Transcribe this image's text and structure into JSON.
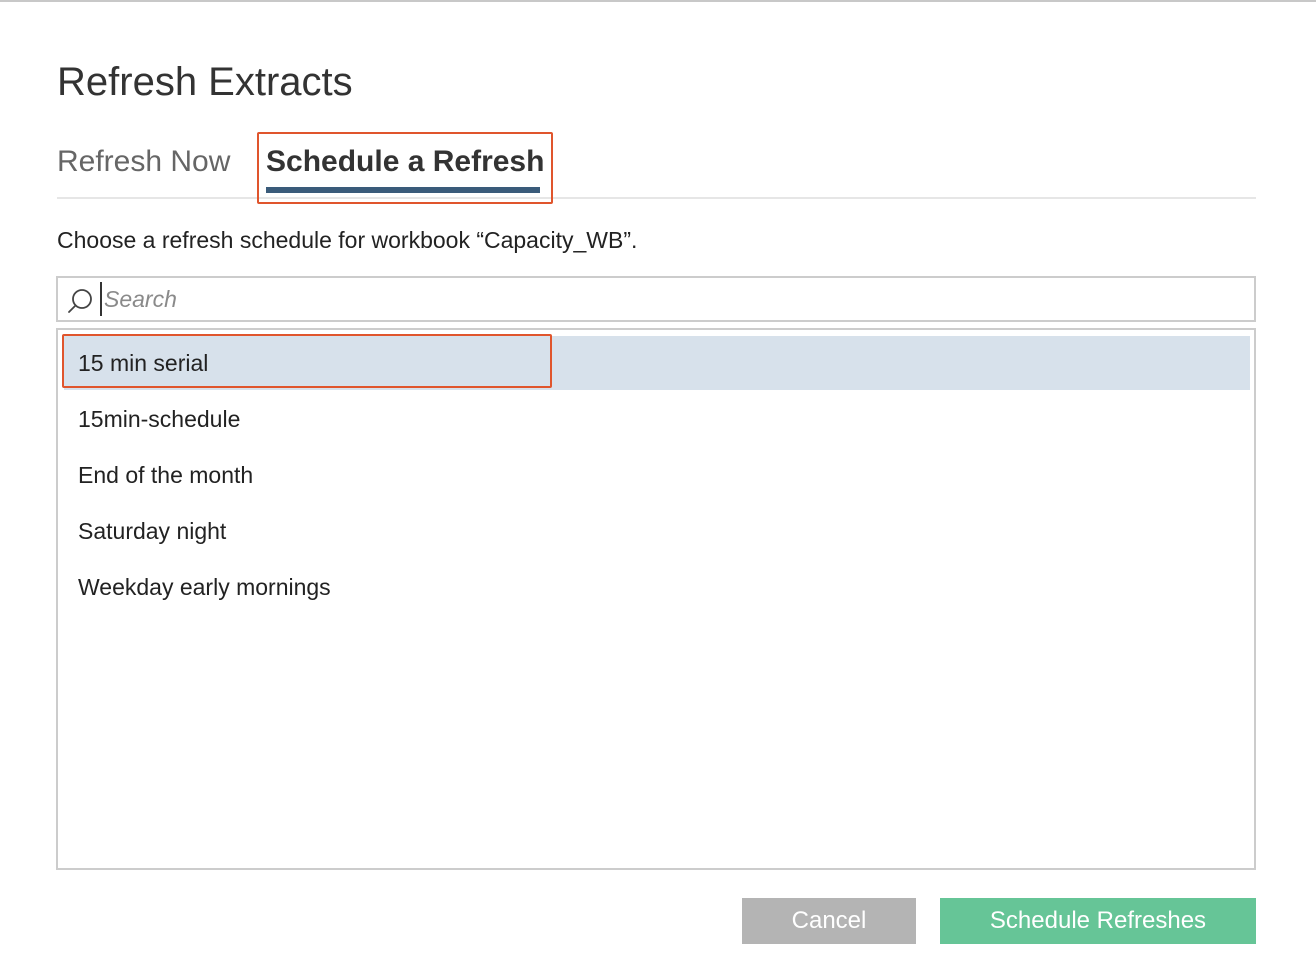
{
  "dialog": {
    "title": "Refresh Extracts",
    "description": "Choose a refresh schedule for workbook “Capacity_WB”."
  },
  "tabs": [
    {
      "label": "Refresh Now",
      "active": false
    },
    {
      "label": "Schedule a Refresh",
      "active": true
    }
  ],
  "search": {
    "placeholder": "Search",
    "value": "",
    "icon": "search-icon"
  },
  "schedules": [
    {
      "label": "15 min serial",
      "selected": true
    },
    {
      "label": "15min-schedule",
      "selected": false
    },
    {
      "label": "End of the month",
      "selected": false
    },
    {
      "label": "Saturday night",
      "selected": false
    },
    {
      "label": "Weekday early mornings",
      "selected": false
    }
  ],
  "buttons": {
    "cancel_label": "Cancel",
    "submit_label": "Schedule Refreshes"
  },
  "colors": {
    "active_tab_underline": "#3a5b7a",
    "selected_row": "#d7e1eb",
    "annotation_border": "#e0552d",
    "cancel_button": "#b4b4b4",
    "submit_button": "#66c597"
  }
}
